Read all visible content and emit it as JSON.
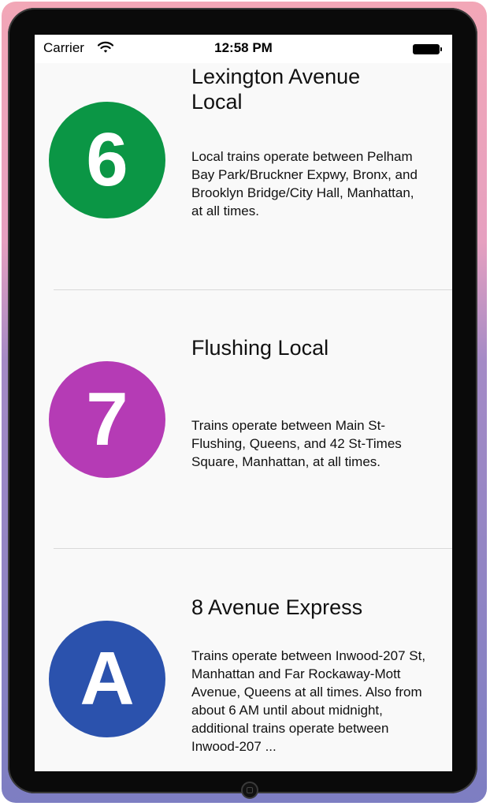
{
  "status_bar": {
    "carrier": "Carrier",
    "time": "12:58 PM"
  },
  "routes": [
    {
      "symbol": "6",
      "color": "#0b9645",
      "title_line1": "Lexington Avenue",
      "title_line2": "Local",
      "description": "Local trains operate between Pelham Bay Park/Bruckner Expwy, Bronx, and Brooklyn Bridge/City Hall, Manhattan, at all times."
    },
    {
      "symbol": "7",
      "color": "#b53bb5",
      "title": "Flushing Local",
      "description": "Trains operate between Main St-Flushing, Queens, and 42 St-Times Square, Manhattan, at all times."
    },
    {
      "symbol": "A",
      "color": "#2b52ad",
      "title": "8 Avenue Express",
      "description": "Trains operate between Inwood-207 St, Manhattan and Far Rockaway-Mott Avenue, Queens at all times. Also from about 6 AM until about midnight, additional trains operate between Inwood-207 ..."
    }
  ],
  "icons": {
    "wifi": "wifi-icon",
    "battery": "battery-icon",
    "home_button": "home-button-icon"
  }
}
